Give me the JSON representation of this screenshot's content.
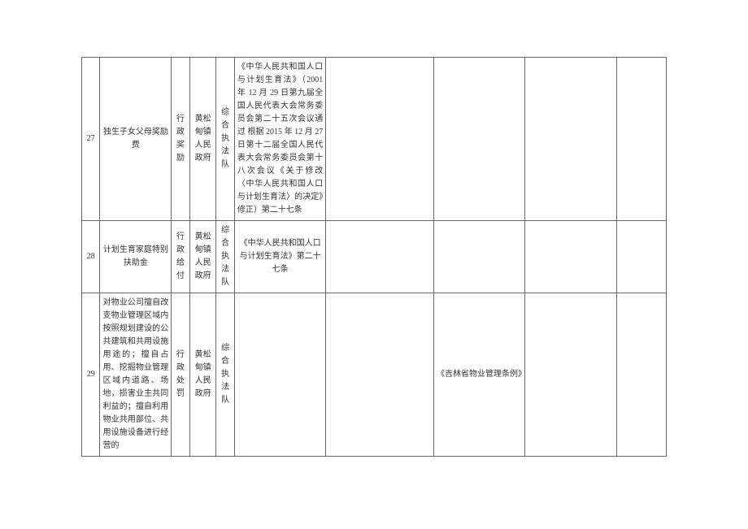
{
  "rows": [
    {
      "num": "27",
      "item": "独生子女父母奖励费",
      "type": "行政奖励",
      "agency": "黄松甸镇人民政府",
      "team": "综合执法队",
      "basis": "《中华人民共和国人口与计划生育法》（2001 年 12 月 29 日第九届全国人民代表大会常务委员会第二十五次会议通过 根据 2015 年 12 月 27 日第十二届全国人民代表大会常务委员会第十八次会议《关于修改〈中华人民共和国人口与计划生育法〉的决定》修正）第二十七条",
      "c7": "",
      "c8": "",
      "c9": "",
      "c10": ""
    },
    {
      "num": "28",
      "item": "计划生育家庭特别扶助金",
      "type": "行政给付",
      "agency": "黄松甸镇人民政府",
      "team": "综合执法队",
      "basis": "《中华人民共和国人口与计划生育法》第二十七条",
      "c7": "",
      "c8": "",
      "c9": "",
      "c10": ""
    },
    {
      "num": "29",
      "item": "对物业公司擅自改变物业管理区域内按照规划建设的公共建筑和共用设施用途的；擅自占用、挖掘物业管理区域内道路、场地，损害业主共同利益的；擅自利用物业共用部位、共用设施设备进行经营的",
      "type": "行政处罚",
      "agency": "黄松甸镇人民政府",
      "team": "综合执法队",
      "basis": "",
      "c7": "",
      "c8": "《吉林省物业管理条例》",
      "c9": "",
      "c10": ""
    }
  ]
}
